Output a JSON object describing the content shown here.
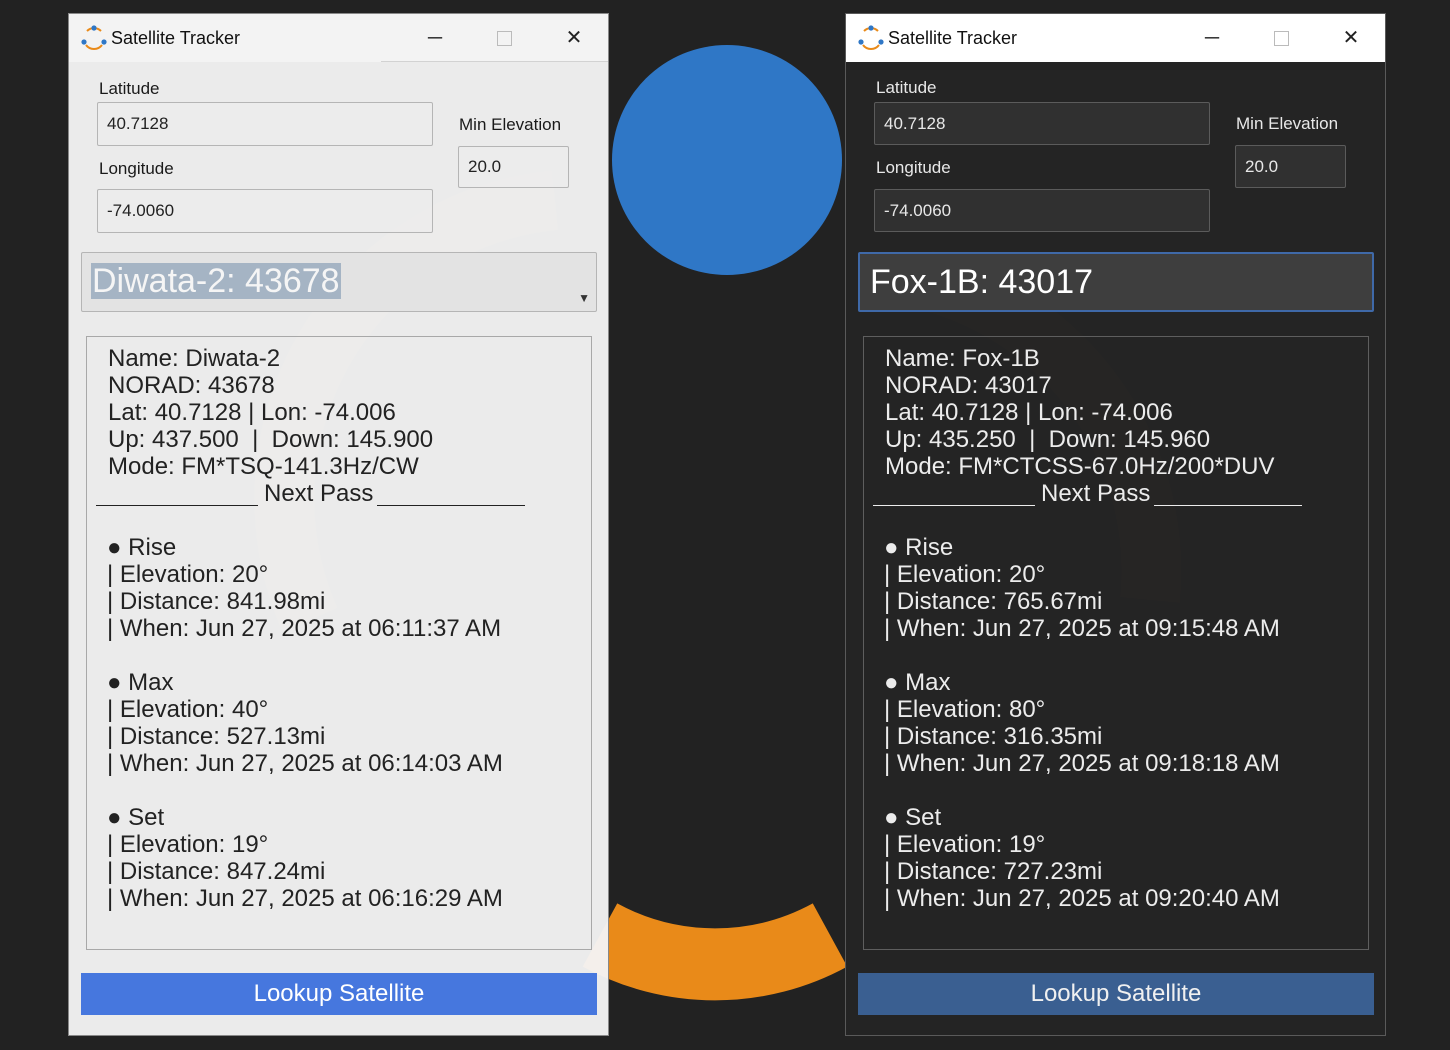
{
  "colors": {
    "background": "#222222",
    "logo_blue": "#2f77c6",
    "logo_orange": "#e98a19",
    "light_button": "#4677de",
    "dark_button": "#3a5f91",
    "dark_combo_border": "#3f69a8"
  },
  "windows": [
    {
      "theme": "light",
      "title": "Satellite Tracker",
      "icon": "app-satellite-icon",
      "latitude_label": "Latitude",
      "latitude_value": "40.7128",
      "longitude_label": "Longitude",
      "longitude_value": "-74.0060",
      "min_elevation_label": "Min Elevation",
      "min_elevation_value": "20.0",
      "selected_satellite": "Diwata-2: 43678",
      "info": {
        "name": "Name: Diwata-2",
        "norad": "NORAD: 43678",
        "latlon": "Lat: 40.7128 | Lon: -74.006",
        "freq": "Up: 437.500  |  Down: 145.900",
        "mode": "Mode: FM*TSQ-141.3Hz/CW",
        "next_pass": "Next Pass",
        "rise_title": "● Rise",
        "rise_elev": "| Elevation: 20°",
        "rise_dist": "| Distance: 841.98mi",
        "rise_when": "| When: Jun 27, 2025 at 06:11:37 AM",
        "max_title": "● Max",
        "max_elev": "| Elevation: 40°",
        "max_dist": "| Distance: 527.13mi",
        "max_when": "| When: Jun 27, 2025 at 06:14:03 AM",
        "set_title": "● Set",
        "set_elev": "| Elevation: 19°",
        "set_dist": "| Distance: 847.24mi",
        "set_when": "| When: Jun 27, 2025 at 06:16:29 AM"
      },
      "lookup_label": "Lookup Satellite"
    },
    {
      "theme": "dark",
      "title": "Satellite Tracker",
      "icon": "app-satellite-icon",
      "latitude_label": "Latitude",
      "latitude_value": "40.7128",
      "longitude_label": "Longitude",
      "longitude_value": "-74.0060",
      "min_elevation_label": "Min Elevation",
      "min_elevation_value": "20.0",
      "selected_satellite": "Fox-1B: 43017",
      "info": {
        "name": "Name: Fox-1B",
        "norad": "NORAD: 43017",
        "latlon": "Lat: 40.7128 | Lon: -74.006",
        "freq": "Up: 435.250  |  Down: 145.960",
        "mode": "Mode: FM*CTCSS-67.0Hz/200*DUV",
        "next_pass": "Next Pass",
        "rise_title": "● Rise",
        "rise_elev": "| Elevation: 20°",
        "rise_dist": "| Distance: 765.67mi",
        "rise_when": "| When: Jun 27, 2025 at 09:15:48 AM",
        "max_title": "● Max",
        "max_elev": "| Elevation: 80°",
        "max_dist": "| Distance: 316.35mi",
        "max_when": "| When: Jun 27, 2025 at 09:18:18 AM",
        "set_title": "● Set",
        "set_elev": "| Elevation: 19°",
        "set_dist": "| Distance: 727.23mi",
        "set_when": "| When: Jun 27, 2025 at 09:20:40 AM"
      },
      "lookup_label": "Lookup Satellite"
    }
  ]
}
